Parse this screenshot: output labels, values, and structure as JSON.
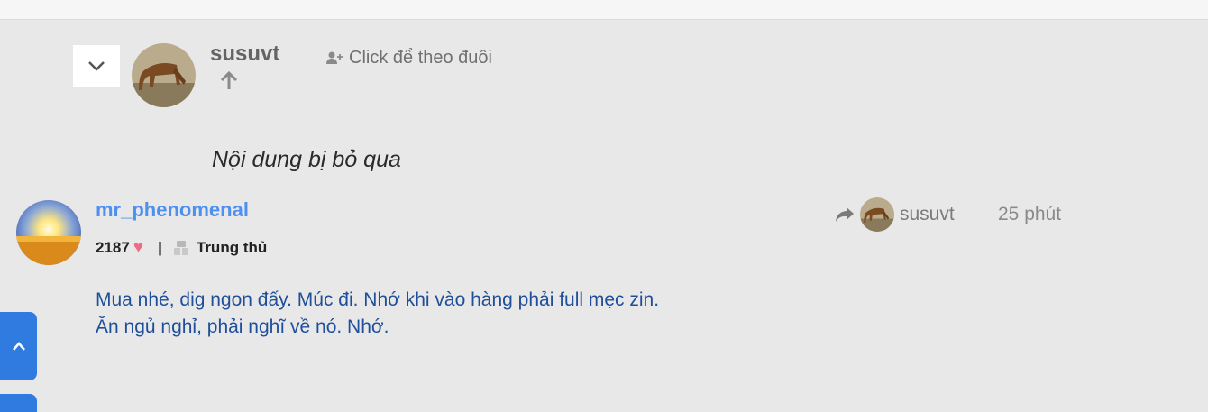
{
  "parent_post": {
    "username": "susuvt",
    "follow_label": "Click để theo đuôi",
    "collapse_icon": "chevron-down-icon",
    "up_icon": "arrow-up-icon"
  },
  "skipped_content": "Nội dung bị bỏ qua",
  "post": {
    "username": "mr_phenomenal",
    "likes": "2187",
    "rank": "Trung thủ",
    "reply_to_user": "susuvt",
    "time": "25 phút",
    "body_lines": [
      "Mua nhé, dig ngon đấy. Múc đi. Nhớ khi vào hàng phải full mẹc zin.",
      "Ăn ngủ nghỉ, phải nghĩ về nó. Nhớ."
    ]
  },
  "colors": {
    "username_link": "#4d90f0",
    "body_text": "#1f4f9a",
    "heart": "#f06a86",
    "scroll_button": "#2f7be0"
  }
}
